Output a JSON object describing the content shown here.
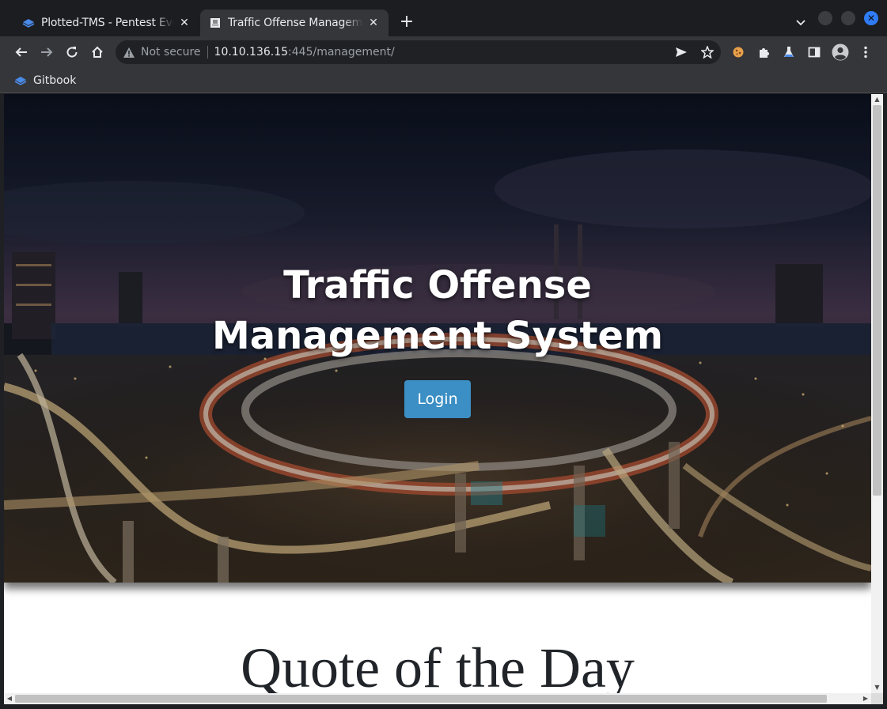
{
  "browser": {
    "tabs": [
      {
        "title": "Plotted-TMS - Pentest Eve",
        "icon": "gitbook-icon",
        "active": false
      },
      {
        "title": "Traffic Offense Manageme",
        "icon": "page-icon",
        "active": true
      }
    ],
    "new_tab": "+",
    "address": {
      "security_label": "Not secure",
      "host": "10.10.136.15",
      "rest": ":445/management/"
    },
    "bookmarks": [
      {
        "label": "Gitbook",
        "icon": "gitbook-icon"
      }
    ]
  },
  "page": {
    "hero_title": "Traffic Offense Management System",
    "login_label": "Login",
    "quote_title": "Quote of the Day"
  },
  "colors": {
    "login_button": "#3b8fc4",
    "browser_frame": "#35363a",
    "tab_strip": "#1c1d20"
  }
}
